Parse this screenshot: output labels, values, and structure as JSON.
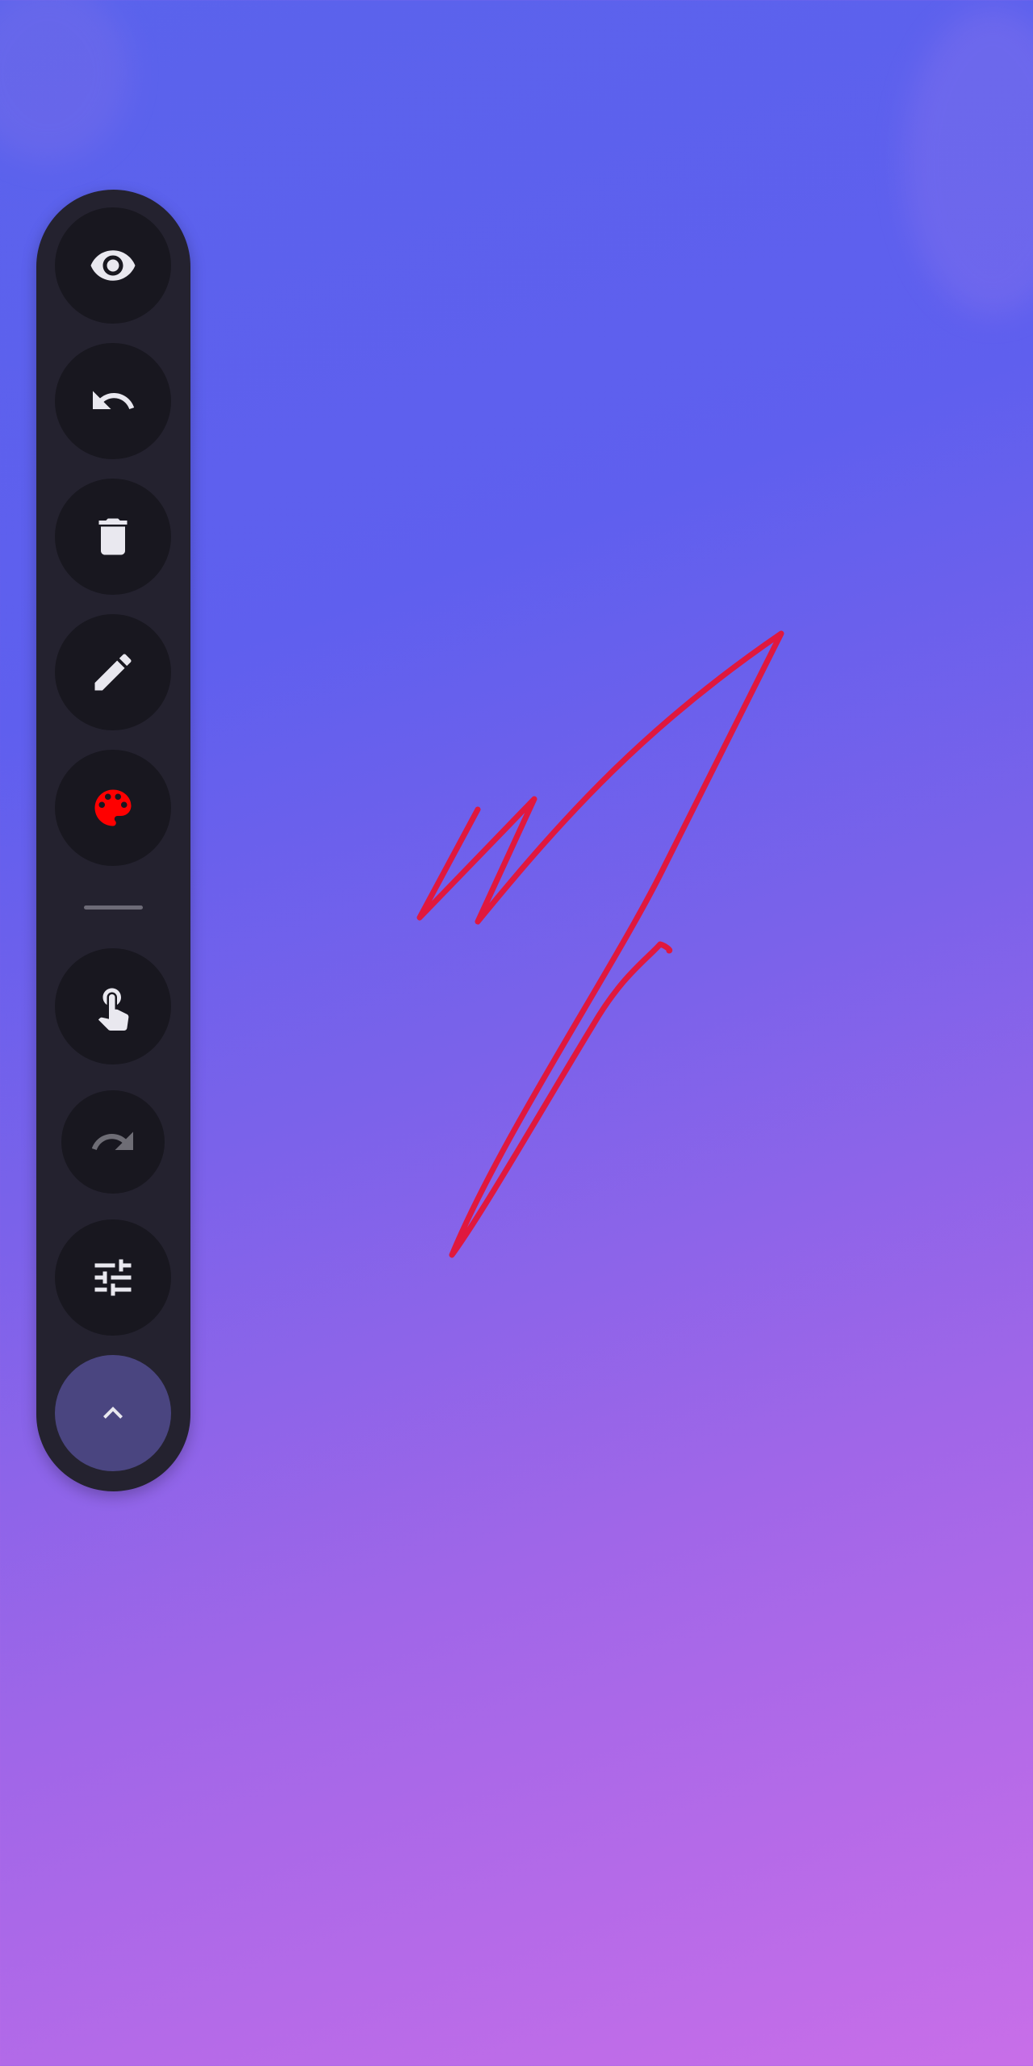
{
  "toolbar": {
    "buttons": [
      {
        "name": "visibility",
        "icon": "eye-icon"
      },
      {
        "name": "undo",
        "icon": "undo-icon"
      },
      {
        "name": "delete",
        "icon": "trash-icon"
      },
      {
        "name": "pen",
        "icon": "pencil-icon"
      },
      {
        "name": "color",
        "icon": "palette-icon",
        "current_color": "#ff0000"
      },
      {
        "name": "touch-mode",
        "icon": "touch-hand-icon"
      },
      {
        "name": "redo",
        "icon": "redo-icon",
        "enabled": false
      },
      {
        "name": "settings",
        "icon": "sliders-icon"
      },
      {
        "name": "collapse",
        "icon": "chevron-up-icon"
      }
    ],
    "icon_color": "#e9e8ef",
    "disabled_icon_color": "#6e6d75",
    "background_color": "#24222f",
    "button_color": "#18171f",
    "toggle_color": "#4a4580"
  },
  "drawing": {
    "stroke_color": "#e0183e"
  },
  "background": {
    "gradient_start": "#5a63ec",
    "gradient_end": "#c86ee8"
  }
}
